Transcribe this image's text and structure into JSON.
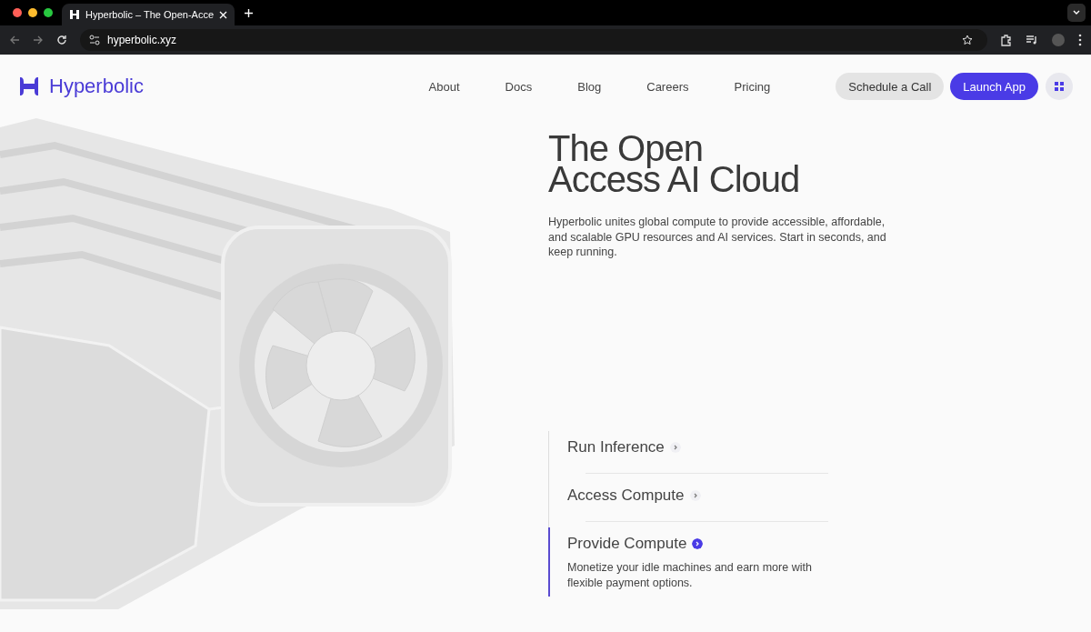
{
  "browser": {
    "tab_title": "Hyperbolic – The Open-Acce",
    "url": "hyperbolic.xyz"
  },
  "header": {
    "brand": "Hyperbolic",
    "nav": [
      "About",
      "Docs",
      "Blog",
      "Careers",
      "Pricing"
    ],
    "buttons": [
      {
        "label": "Schedule a Call",
        "kind": "secondary"
      },
      {
        "label": "Launch App",
        "kind": "primary"
      }
    ]
  },
  "hero": {
    "title_lines": [
      "The Open",
      "Access AI Cloud"
    ],
    "description": "Hyperbolic unites global compute to provide accessible, affordable, and scalable GPU resources and AI services. Start in seconds, and keep running."
  },
  "features": [
    {
      "title": "Run Inference",
      "selected": false
    },
    {
      "title": "Access Compute",
      "selected": false
    },
    {
      "title": "Provide Compute",
      "selected": true,
      "description": "Monetize your idle machines and earn more with flexible payment options."
    }
  ]
}
